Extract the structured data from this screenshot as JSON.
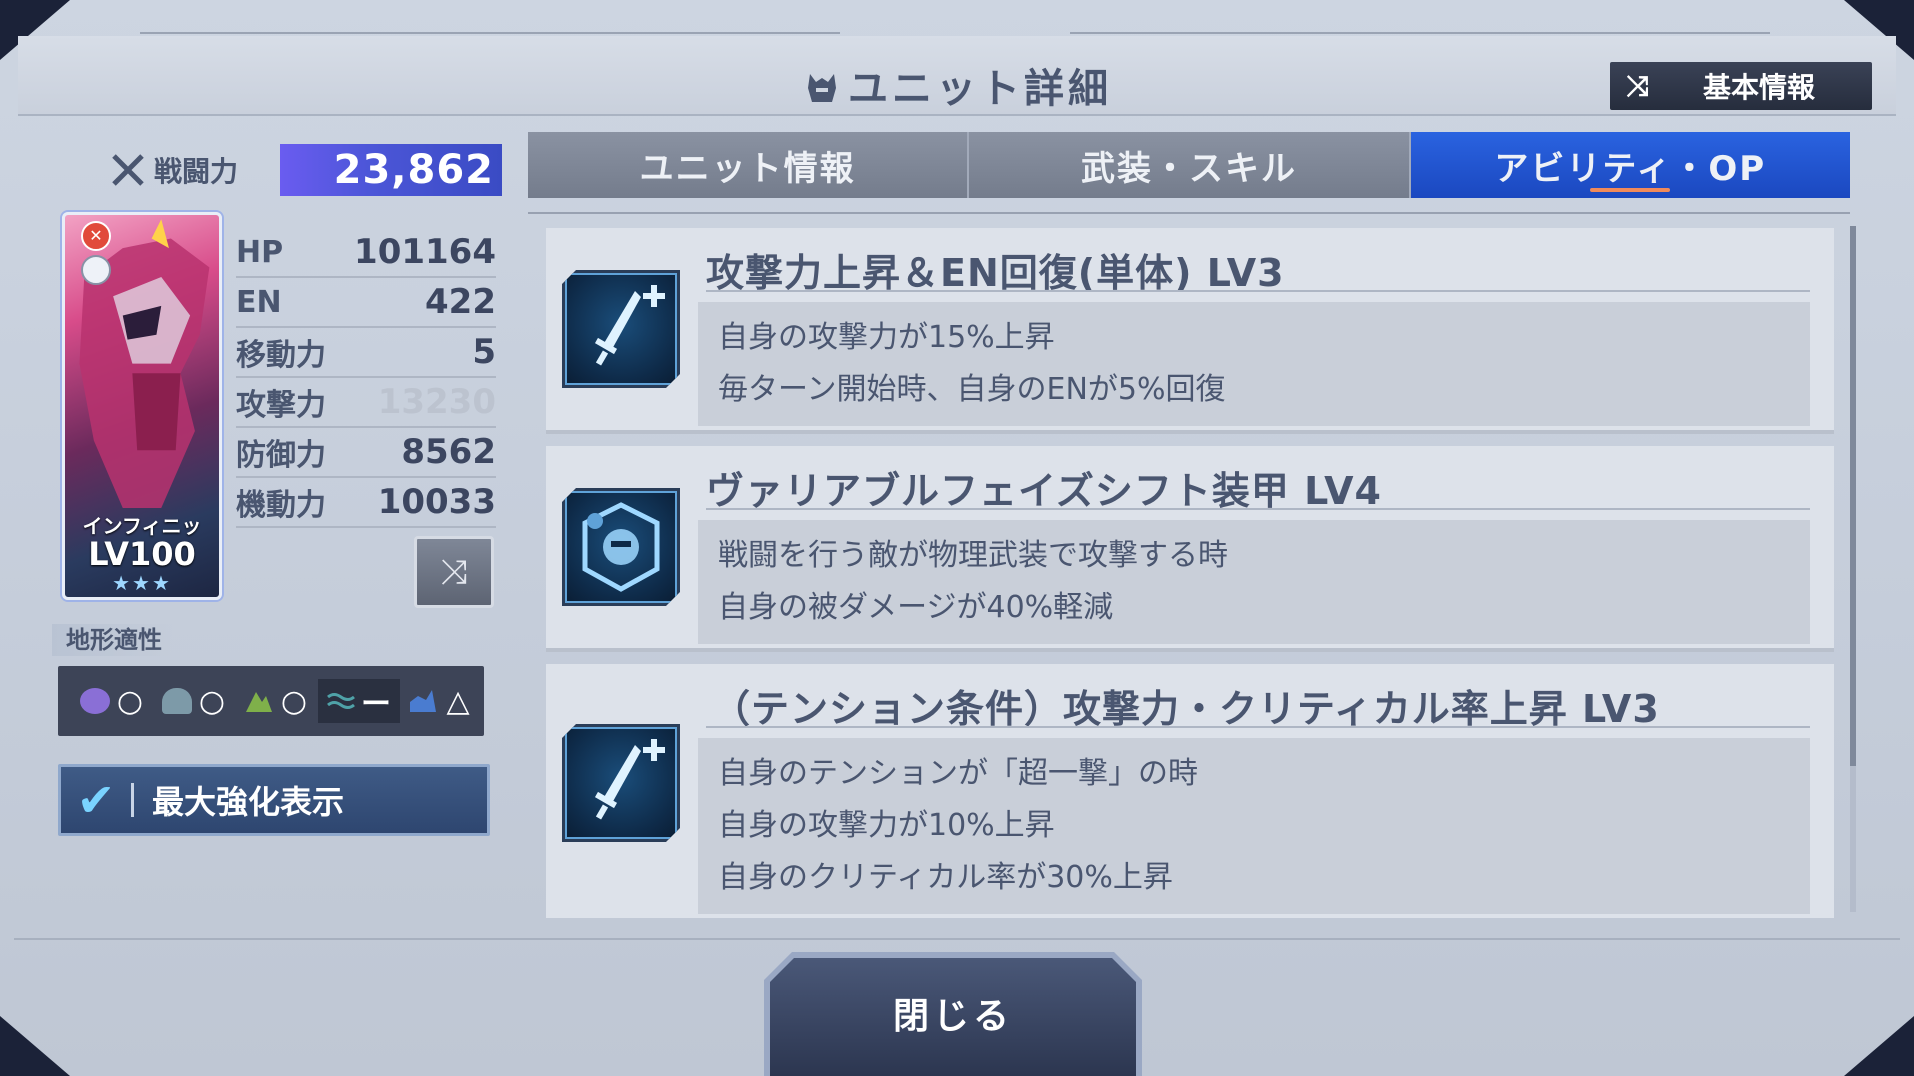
{
  "header": {
    "title": "ユニット詳細",
    "title_icon": "mech-head-icon",
    "basic_info_button": "基本情報",
    "basic_info_icon": "shuffle-icon"
  },
  "unit": {
    "power_label": "戦闘力",
    "power_value": "23,862",
    "name": "インフィニッ",
    "level": "LV100",
    "stars": "★★★",
    "stats": [
      {
        "label": "HP",
        "value": "101164"
      },
      {
        "label": "EN",
        "value": "422"
      },
      {
        "label": "移動力",
        "value": "5"
      },
      {
        "label": "攻撃力",
        "value": "13230"
      },
      {
        "label": "防御力",
        "value": "8562"
      },
      {
        "label": "機動力",
        "value": "10033"
      }
    ]
  },
  "terrain": {
    "label": "地形適性",
    "items": [
      {
        "icon": "space-icon",
        "mark": "○",
        "color": "#8a6fd6"
      },
      {
        "icon": "air-icon",
        "mark": "○",
        "color": "#7d9aa8"
      },
      {
        "icon": "ground-icon",
        "mark": "○",
        "color": "#7fb04a"
      },
      {
        "icon": "water-icon",
        "mark": "ー",
        "color": "#4fa2a8"
      },
      {
        "icon": "underwater-icon",
        "mark": "△",
        "color": "#4a7cd0"
      }
    ]
  },
  "max_enhance": {
    "label": "最大強化表示",
    "checked": true
  },
  "tabs": [
    {
      "label": "ユニット情報",
      "active": false
    },
    {
      "label": "武装・スキル",
      "active": false
    },
    {
      "label": "アビリティ・OP",
      "active": true
    }
  ],
  "abilities": [
    {
      "icon": "sword-plus-icon",
      "title": "攻撃力上昇＆EN回復(単体) LV3",
      "lines": [
        "自身の攻撃力が15%上昇",
        "毎ターン開始時、自身のENが5%回復"
      ]
    },
    {
      "icon": "armor-shield-icon",
      "title": "ヴァリアブルフェイズシフト装甲 LV4",
      "lines": [
        "戦闘を行う敵が物理武装で攻撃する時",
        "自身の被ダメージが40%軽減"
      ]
    },
    {
      "icon": "sword-plus-icon",
      "title": "（テンション条件）攻撃力・クリティカル率上昇 LV3",
      "lines": [
        "自身のテンションが「超一撃」の時",
        "自身の攻撃力が10%上昇",
        "自身のクリティカル率が30%上昇"
      ]
    }
  ],
  "close_button": "閉じる"
}
